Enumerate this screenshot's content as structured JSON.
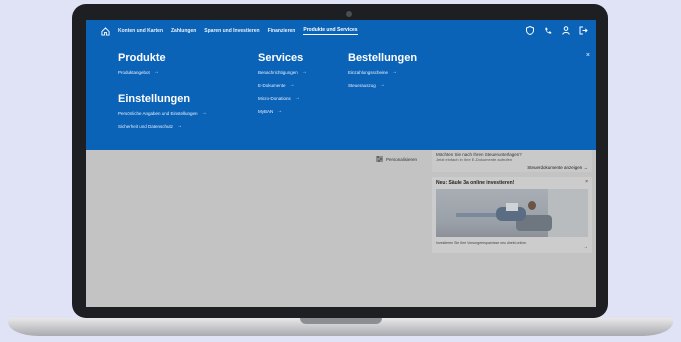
{
  "nav": {
    "items": [
      "Konten und Karten",
      "Zahlungen",
      "Sparen und Investieren",
      "Finanzieren",
      "Produkte und Services"
    ],
    "active_index": 4,
    "icons": [
      "home-icon",
      "shield-icon",
      "phone-icon",
      "user-icon",
      "logout-icon"
    ]
  },
  "mega": {
    "produkte": {
      "title": "Produkte",
      "links": [
        "Produktangebot"
      ]
    },
    "einstellungen": {
      "title": "Einstellungen",
      "links": [
        "Persönliche Angaben und Einstellungen",
        "Sicherheit und Datenschutz"
      ]
    },
    "services": {
      "title": "Services",
      "links": [
        "Benachrichtigungen",
        "E-Dokumente",
        "Micro-Donations",
        "MyBAN"
      ]
    },
    "bestellungen": {
      "title": "Bestellungen",
      "links": [
        "Einzahlungsscheine",
        "Steuerauszug"
      ]
    },
    "arrow": "→",
    "close": "×"
  },
  "content": {
    "personalize_label": "Personalisieren",
    "card_docs": {
      "title": "Möchten Sie nach Ihren Steuerunterlagen?",
      "subtitle": "Jetzt einfach in Ihre E-Dokumente aufrufen",
      "action": "Steuerdokumente anzeigen"
    },
    "card_invest": {
      "title": "Neu: Säule 3a online investieren!",
      "description": "Investieren Sie Ihre Vorsorgeersparnisse neu direkt online."
    }
  },
  "colors": {
    "primary": "#0b63b8",
    "overlay": "#c3c3c3",
    "frame": "#1e1f22"
  }
}
